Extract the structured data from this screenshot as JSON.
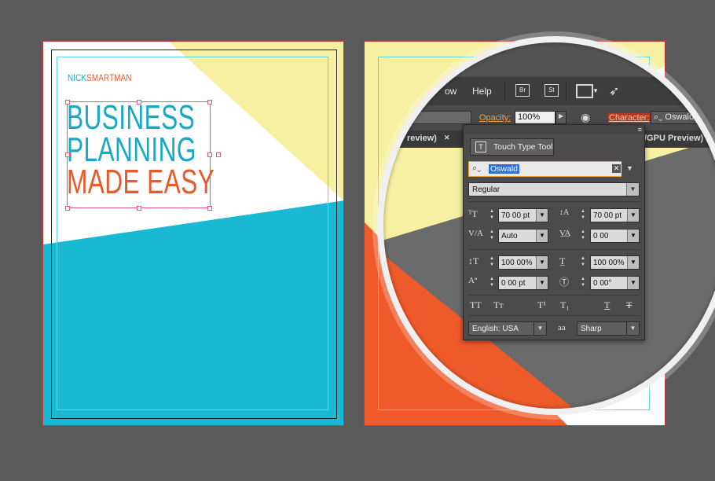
{
  "left_page": {
    "brand_part1": "NICK",
    "brand_part2": "SMARTMAN",
    "headline_line1": "BUSINESS",
    "headline_line2": "PLANNING",
    "headline_line3": "MADE EASY",
    "colors": {
      "blue": "#1aa9c5",
      "orange": "#e85a2a",
      "yellow": "#f7f0a2",
      "guide": "#58d7e6",
      "bleed": "#c83a3a"
    }
  },
  "app": {
    "menu": {
      "view": "ow",
      "help": "Help",
      "bridge": "Br",
      "stock": "St"
    },
    "control": {
      "opacity_label": "Opacity:",
      "opacity_value": "100%",
      "character_label": "Character:",
      "character_font": "Oswald"
    },
    "tabs": {
      "left_tab": "review)",
      "right_tab": "/GPU Preview)"
    },
    "character_panel": {
      "touch_type_label": "Touch Type Tool",
      "font_family": "Oswald",
      "font_style": "Regular",
      "font_size": "70 00 pt",
      "leading": "70 00 pt",
      "kerning": "Auto",
      "tracking": "0 00",
      "vertical_scale": "100 00%",
      "horizontal_scale": "100 00%",
      "baseline_shift": "0 00 pt",
      "rotation": "0 00°",
      "language": "English: USA",
      "antialias_label": "aa",
      "antialias": "Sharp",
      "glyph_allcaps": "TT",
      "glyph_smallcaps": "Tт",
      "glyph_superscript": "T¹",
      "glyph_subscript": "T₁",
      "glyph_underline": "T",
      "glyph_strike": "T"
    }
  }
}
